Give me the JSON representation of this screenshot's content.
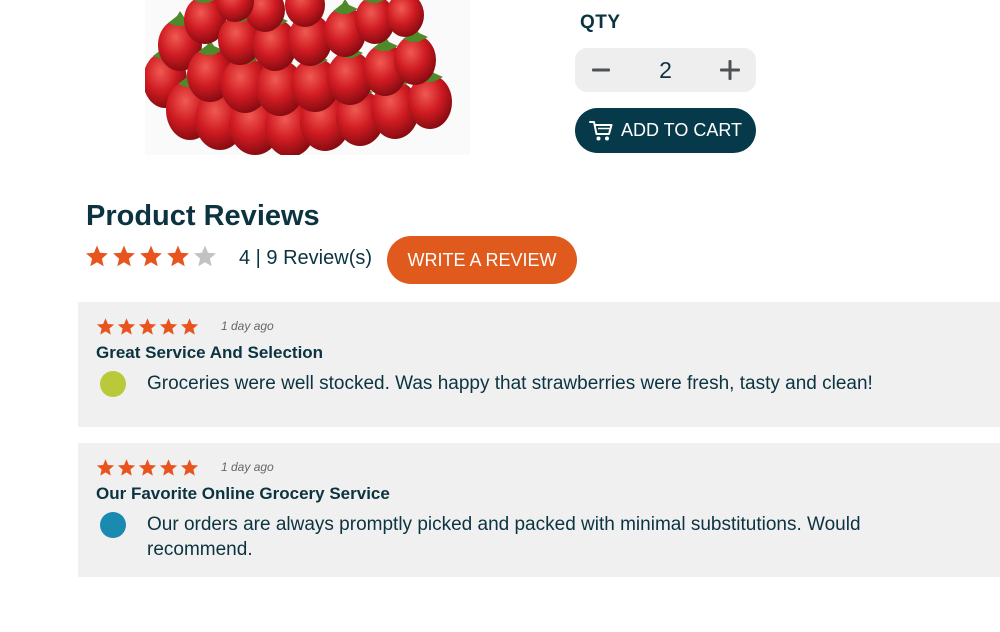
{
  "product": {
    "image_alt": "strawberries",
    "qty_label": "QTY",
    "qty_value": "2",
    "add_to_cart_label": "ADD TO CART"
  },
  "reviews": {
    "title": "Product Reviews",
    "rating": 4,
    "summary": "4 | 9 Review(s)",
    "write_review_label": "WRITE A REVIEW",
    "items": [
      {
        "rating": 5,
        "date": "1 day ago",
        "title": "Great Service And Selection",
        "body": "Groceries were well stocked. Was happy that strawberries were fresh, tasty and clean!",
        "avatar_color": "#b9c93a"
      },
      {
        "rating": 5,
        "date": "1 day ago",
        "title": "Our Favorite Online Grocery Service",
        "body": "Our orders are always promptly picked and packed with minimal substitutions. Would recommend.",
        "avatar_color": "#1a8ab0"
      }
    ]
  },
  "colors": {
    "accent": "#e05a1e",
    "primary": "#063a4a",
    "star_filled": "#e8541e",
    "star_empty": "#c2c2c2",
    "text": "#0b3340"
  }
}
